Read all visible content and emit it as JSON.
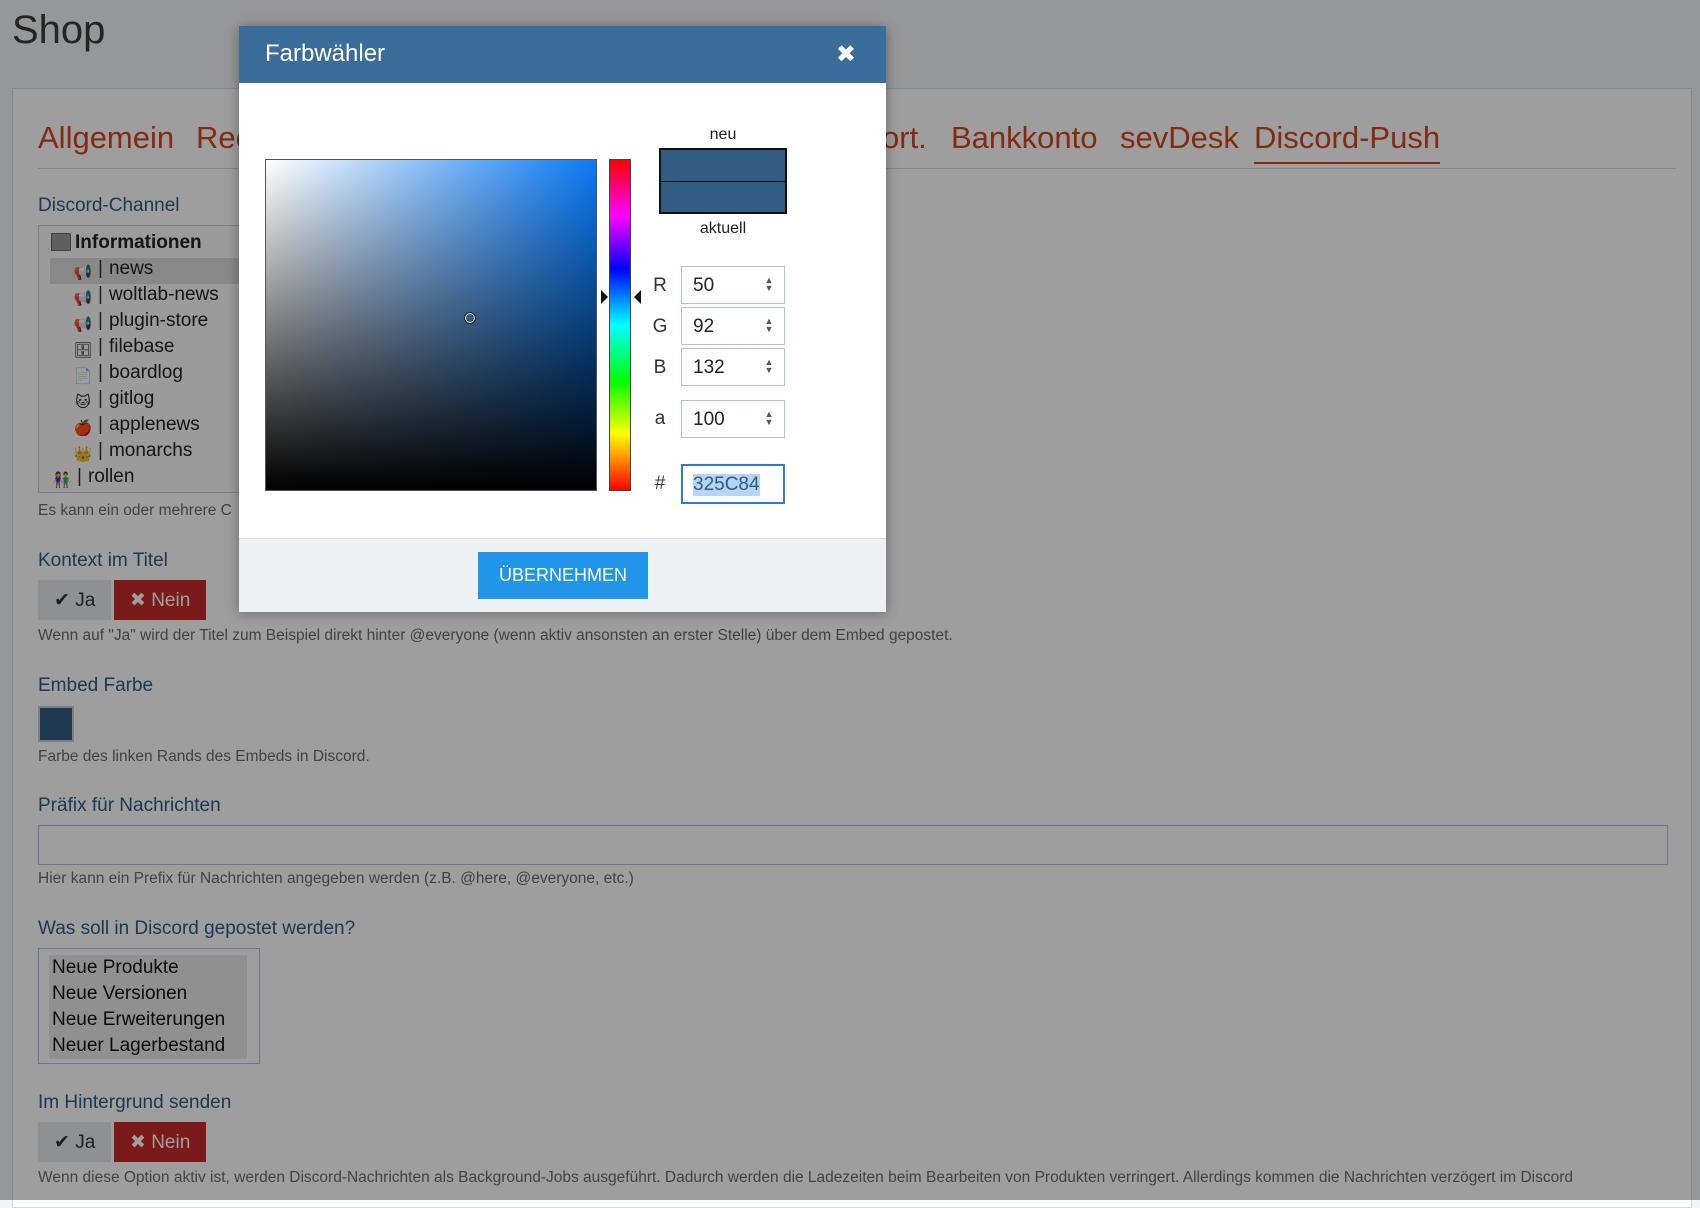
{
  "page": {
    "title": "Shop"
  },
  "tabs": [
    {
      "label": "Allgemein",
      "active": false
    },
    {
      "label": "Rec",
      "active": false
    },
    {
      "label": "ort.",
      "active": false
    },
    {
      "label": "Bankkonto",
      "active": false
    },
    {
      "label": "sevDesk",
      "active": false
    },
    {
      "label": "Discord-Push",
      "active": true
    }
  ],
  "discord_channel": {
    "label": "Discord-Channel",
    "category": "Informationen",
    "channels": [
      {
        "name": "news",
        "icon": "megaphone-icon",
        "glyph": "📢",
        "selected": true
      },
      {
        "name": "woltlab-news",
        "icon": "megaphone-icon",
        "glyph": "📢",
        "selected": false
      },
      {
        "name": "plugin-store",
        "icon": "megaphone-icon",
        "glyph": "📢",
        "selected": false
      },
      {
        "name": "filebase",
        "icon": "file-cabinet-icon",
        "glyph": "🗄",
        "selected": false
      },
      {
        "name": "boardlog",
        "icon": "document-icon",
        "glyph": "📄",
        "selected": false
      },
      {
        "name": "gitlog",
        "icon": "octocat-icon",
        "glyph": "🐱",
        "selected": false
      },
      {
        "name": "applenews",
        "icon": "apple-icon",
        "glyph": "🍎",
        "selected": false
      },
      {
        "name": "monarchs",
        "icon": "crown-icon",
        "glyph": "👑",
        "selected": false
      }
    ],
    "extra": {
      "name": "rollen",
      "icon": "people-icon",
      "glyph": "👫"
    },
    "help": "Es kann ein oder mehrere C"
  },
  "context_title": {
    "label": "Kontext im Titel",
    "yes": "Ja",
    "no": "Nein",
    "help": "Wenn auf \"Ja\" wird der Titel zum Beispiel direkt hinter @everyone (wenn aktiv ansonsten an erster Stelle) über dem Embed gepostet."
  },
  "embed_color": {
    "label": "Embed Farbe",
    "value": "#325C84",
    "help": "Farbe des linken Rands des Embeds in Discord."
  },
  "prefix": {
    "label": "Präfix für Nachrichten",
    "value": "",
    "help": "Hier kann ein Prefix für Nachrichten angegeben werden (z.B. @here, @everyone, etc.)"
  },
  "post_options": {
    "label": "Was soll in Discord gepostet werden?",
    "items": [
      "Neue Produkte",
      "Neue Versionen",
      "Neue Erweiterungen",
      "Neuer Lagerbestand"
    ]
  },
  "background_send": {
    "label": "Im Hintergrund senden",
    "yes": "Ja",
    "no": "Nein",
    "help": "Wenn diese Option aktiv ist, werden Discord-Nachrichten als Background-Jobs ausgeführt. Dadurch werden die Ladezeiten beim Bearbeiten von Produkten verringert. Allerdings kommen die Nachrichten verzögert im Discord"
  },
  "color_picker": {
    "title": "Farbwähler",
    "close_icon": "close-icon",
    "label_new": "neu",
    "label_current": "aktuell",
    "new_color": "#325C84",
    "current_color": "#325C84",
    "r_label": "R",
    "r": "50",
    "g_label": "G",
    "g": "92",
    "b_label": "B",
    "b": "132",
    "a_label": "a",
    "a": "100",
    "hex_label": "#",
    "hex": "325C84",
    "apply_label": "ÜBERNEHMEN"
  },
  "colors": {
    "tab_accent": "#d2461b",
    "label_blue": "#2b5c8a",
    "header_blue": "#3a6d9a",
    "apply_blue": "#2196e8",
    "danger_red": "#c62a2a"
  }
}
